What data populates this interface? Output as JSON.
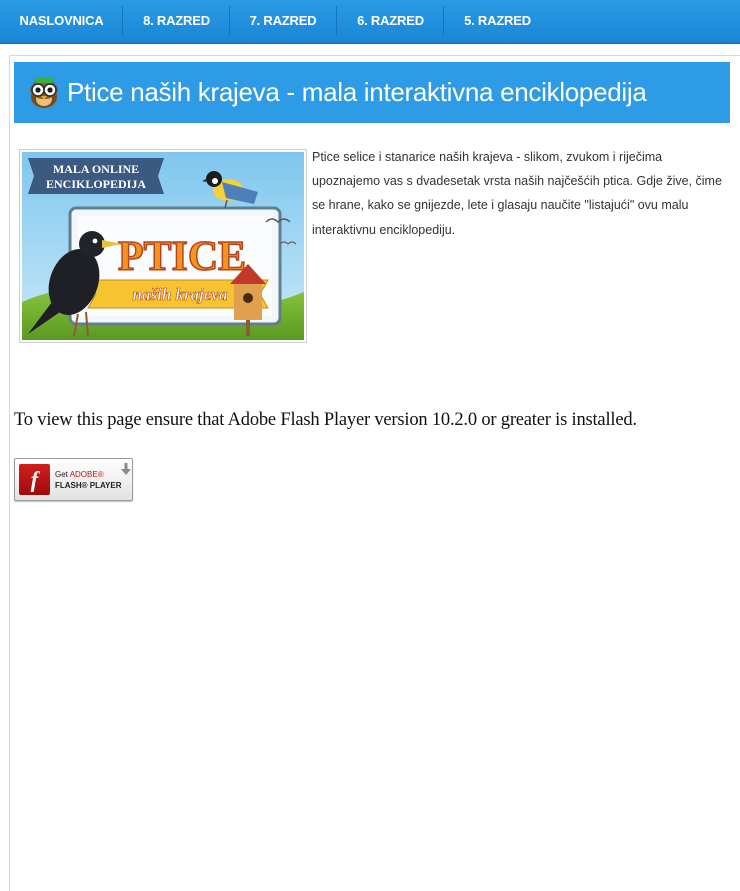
{
  "nav": {
    "items": [
      {
        "label": "NASLOVNICA"
      },
      {
        "label": "8. RAZRED"
      },
      {
        "label": "7. RAZRED"
      },
      {
        "label": "6. RAZRED"
      },
      {
        "label": "5. RAZRED"
      }
    ]
  },
  "colors": {
    "nav_bg": "#1f8fdd",
    "title_bg": "#2d9be6",
    "title_text": "#ffffff",
    "body_text": "#333333"
  },
  "page": {
    "title": "Ptice naših krajeva - mala interaktivna enciklopedija",
    "title_icon": "owl-icon"
  },
  "thumbnail": {
    "banner": {
      "line1": "MALA ONLINE",
      "line2": "ENCIKLOPEDIJA"
    },
    "headline": "PTICE",
    "subline": "naših krajeva"
  },
  "description": "Ptice selice i stanarice naših krajeva - slikom, zvukom i riječima upoznajemo vas s dvadesetak vrsta naših najčešćih ptica. Gdje žive, čime se hrane, kako se gnijezde, lete i glasaju naučite \"listajući\" ovu malu interaktivnu enciklopediju.",
  "flash": {
    "message": "To view this page ensure that Adobe Flash Player version 10.2.0 or greater is installed.",
    "badge": {
      "get": "Get",
      "adobe": "ADOBE®",
      "product": "FLASH® PLAYER",
      "icon": "download-arrow-icon"
    }
  }
}
